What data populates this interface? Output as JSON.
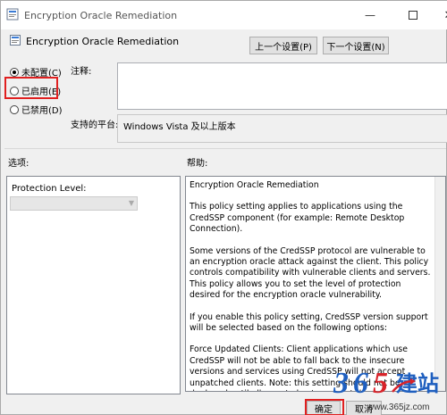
{
  "window": {
    "title": "Encryption Oracle Remediation"
  },
  "header": {
    "policy_title": "Encryption Oracle Remediation",
    "prev_button": "上一个设置(P)",
    "next_button": "下一个设置(N)"
  },
  "state": {
    "options": [
      {
        "label": "未配置(C)",
        "selected": true
      },
      {
        "label": "已启用(E)",
        "selected": false
      },
      {
        "label": "已禁用(D)",
        "selected": false
      }
    ]
  },
  "comment": {
    "label": "注释:",
    "value": ""
  },
  "platform": {
    "label": "支持的平台:",
    "value": "Windows Vista 及以上版本"
  },
  "options_section": {
    "label": "选项:",
    "protection_label": "Protection Level:",
    "protection_value": ""
  },
  "help_section": {
    "label": "帮助:",
    "paragraphs": [
      "Encryption Oracle Remediation",
      "This policy setting applies to applications using the CredSSP component (for example: Remote Desktop Connection).",
      "Some versions of the CredSSP protocol are vulnerable to an encryption oracle attack against the client.  This policy controls compatibility with vulnerable clients and servers.  This policy allows you to set the level of protection desired for the encryption oracle vulnerability.",
      "If you enable this policy setting, CredSSP version support will be selected based on the following options:",
      "Force Updated Clients: Client applications which use CredSSP will not be able to fall back to the insecure versions and services using CredSSP will not accept unpatched clients. Note: this setting should not be deployed until all remote hosts support the newest version."
    ]
  },
  "footer": {
    "ok_button": "确定",
    "cancel_button": "取消"
  },
  "watermark": {
    "logo": "365建站",
    "url": "www.365jz.com"
  },
  "colors": {
    "highlight_box": "#e02020",
    "logo_blue": "#1f5fbf",
    "logo_red": "#d8232a"
  }
}
